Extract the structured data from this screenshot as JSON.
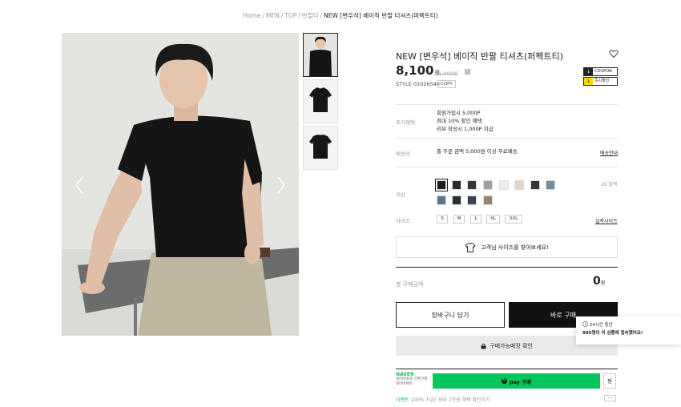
{
  "breadcrumb": {
    "items": [
      "Home",
      "MEN",
      "TOP",
      "반팔티"
    ],
    "current": "NEW [변우석] 베이직 반팔 티셔츠(퍼펙트티)"
  },
  "product": {
    "title": "NEW [변우석] 베이직 반팔 티셔츠(퍼펙트티)",
    "price": "8,100",
    "price_unit": "원",
    "original_price": "11,800원",
    "style_code": "STYLE 01026540",
    "copy_label": "COPY",
    "coupon_label": "COUPON",
    "discount_label": "즉시할인"
  },
  "benefits": {
    "label": "추가혜택",
    "lines": [
      "회원가입시 5,000P",
      "최대 10% 할인 혜택",
      "리뷰 작성시 1,000P 지급"
    ]
  },
  "shipping": {
    "label": "배송비",
    "text": "총 주문 금액 5,000원 이상 무료배송",
    "link": "배송안내"
  },
  "color": {
    "label": "색상",
    "count": "20 블랙",
    "swatches": [
      "#1f1f1f",
      "#2e2b29",
      "#3a3836",
      "#9da29c",
      "#ebebeb",
      "#e3d6c7",
      "#333536",
      "#6f8d9f",
      "#58758c",
      "#2a2f33",
      "#3c4157",
      "#958472"
    ]
  },
  "size": {
    "label": "사이즈",
    "options": [
      "S",
      "M",
      "L",
      "XL",
      "XXL"
    ],
    "link": "실측사이즈"
  },
  "size_finder": {
    "text": "고객님 사이즈를 찾아보세요!"
  },
  "total": {
    "label": "총 구매금액",
    "value": "0",
    "unit": "원"
  },
  "actions": {
    "cart": "장바구니 담기",
    "buy": "바로 구매",
    "store": "구매가능매장 확인"
  },
  "toast": {
    "title": "24시간 동안",
    "count": "885명",
    "message": "이 이 상품에 접속했어요!"
  },
  "naver": {
    "logo": "NAVER",
    "sub1": "네이버ID로 간편구매",
    "sub2": "네이버페이",
    "pay_label": "pay 구매",
    "save_label": "찜",
    "event_tag": "이벤트",
    "event_text": "100% 지급! 최대 1만원 혜택 확인하기",
    "pager": "‹ ›"
  },
  "icons": {
    "heart": "heart-icon",
    "tshirt": "tshirt-icon",
    "lock": "lock-icon",
    "clock": "clock-icon"
  }
}
